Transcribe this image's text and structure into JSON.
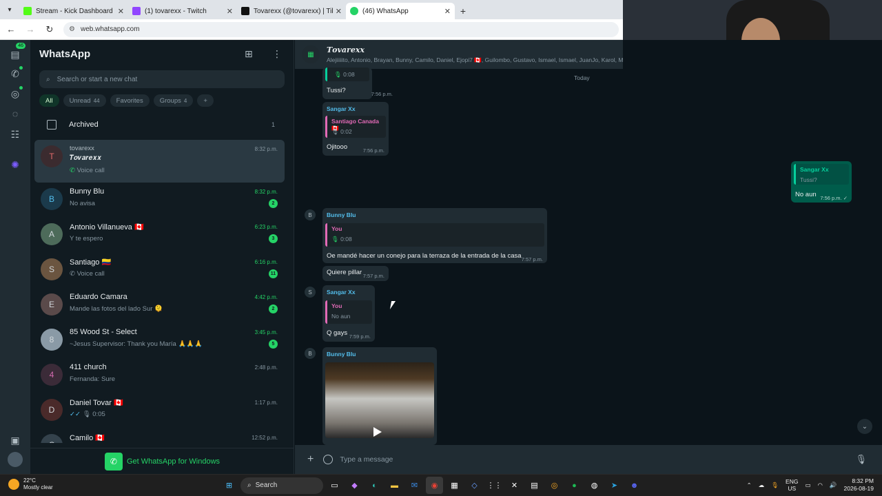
{
  "browser": {
    "tabs": [
      {
        "label": "Stream - Kick Dashboard",
        "color": "#53fc18",
        "active": false
      },
      {
        "label": "(1) tovarexx - Twitch",
        "color": "#9146ff",
        "active": false
      },
      {
        "label": "Tovarexx (@tovarexx) | TikTok",
        "color": "#111111",
        "active": false
      },
      {
        "label": "(46) WhatsApp",
        "color": "#25d366",
        "active": true
      }
    ],
    "url": "web.whatsapp.com"
  },
  "rail": {
    "chats_badge": "46"
  },
  "sidebar": {
    "title": "WhatsApp",
    "search_placeholder": "Search or start a new chat",
    "filters": [
      {
        "label": "All",
        "count": ""
      },
      {
        "label": "Unread",
        "count": "44"
      },
      {
        "label": "Favorites",
        "count": ""
      },
      {
        "label": "Groups",
        "count": "4"
      }
    ],
    "archived": {
      "label": "Archived",
      "count": "1"
    },
    "chats": [
      {
        "name": "tovarexx",
        "subtitle": "𝑻𝒐𝒗𝒂𝒓𝒆𝒙𝒙",
        "preview": "Voice call",
        "time": "8:32 p.m.",
        "unread": "",
        "avatar": "T"
      },
      {
        "name": "Bunny Blu",
        "preview": "No avisa",
        "time": "8:32 p.m.",
        "unread": "2",
        "avatar": "B"
      },
      {
        "name": "Antonio Villanueva 🇨🇦",
        "preview": "Y te espero",
        "time": "6:23 p.m.",
        "unread": "3",
        "avatar": "A"
      },
      {
        "name": "Santiago 🇨🇴",
        "preview": "Voice call",
        "time": "6:16 p.m.",
        "unread": "11",
        "avatar": "S"
      },
      {
        "name": "Eduardo Camara",
        "preview": "Mande las fotos del lado Sur 🫠",
        "time": "4:42 p.m.",
        "unread": "2",
        "avatar": "E"
      },
      {
        "name": "85 Wood St - Select",
        "preview": "~Jesus Supervisor: Thank you María 🙏🙏🙏",
        "time": "3:45 p.m.",
        "unread": "5",
        "avatar": "8"
      },
      {
        "name": "411 church",
        "preview": "Fernanda: Sure",
        "time": "2:48 p.m.",
        "unread": "",
        "avatar": "4"
      },
      {
        "name": "Daniel Tovar 🇨🇦",
        "preview": "0:05",
        "time": "1:17 p.m.",
        "unread": "",
        "avatar": "D"
      },
      {
        "name": "Camilo 🇨🇦",
        "preview": "",
        "time": "12:52 p.m.",
        "unread": "",
        "avatar": "C"
      }
    ],
    "get_windows": "Get WhatsApp for Windows"
  },
  "chat": {
    "title": "𝑻𝒐𝒗𝒂𝒓𝒆𝒙𝒙",
    "members": "Alejiiiiito, Antonio, Brayan, Bunny, Camilo, Daniel, Ejopi7 🇨🇦, Guilombo, Gustavo, Ismael, Ismael, JuanJo, Karol, Mu",
    "date_chip": "Today",
    "messages": [
      {
        "voice": "0:08",
        "text": "Tussi?",
        "time": "7:56 p.m."
      },
      {
        "sender": "Sangar Xx",
        "quote_name": "Santiago Canada 🇨🇦",
        "quote_text": "0:02",
        "text": "Ojitooo",
        "time": "7:56 p.m."
      },
      {
        "sender": "Sangar Xx",
        "quote_text": "Tussi?",
        "text": "No aun",
        "time": "7:56 p.m. ✓"
      },
      {
        "sender": "Bunny Blu",
        "quote_name": "You",
        "quote_text": "0:08",
        "text": "Oe mandé hacer un conejo para la terraza de la entrada de la casa",
        "time": "7:57 p.m."
      },
      {
        "text": "Quiere pillar",
        "time": "7:57 p.m."
      },
      {
        "sender": "Sangar Xx",
        "quote_name": "You",
        "quote_text": "No aun",
        "text": "Q gays",
        "time": "7:59 p.m."
      },
      {
        "sender": "Bunny Blu"
      }
    ],
    "composer_placeholder": "Type a message"
  },
  "taskbar": {
    "temp": "22°C",
    "weather": "Mostly clear",
    "search": "Search",
    "lang": "ENG",
    "region": "US",
    "time": "8:32 PM",
    "date": "2026-08-19"
  }
}
